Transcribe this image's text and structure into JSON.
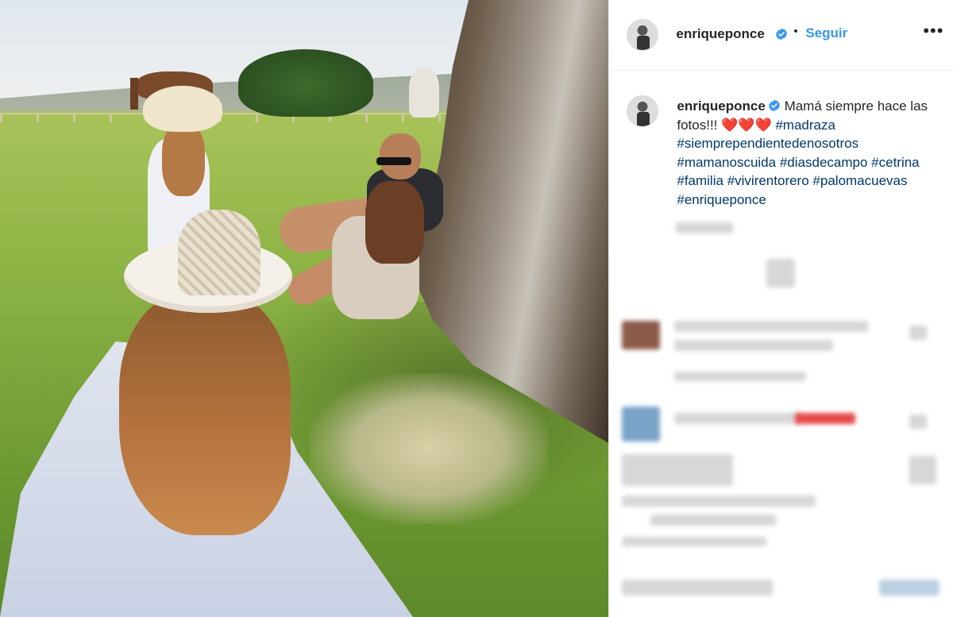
{
  "post": {
    "author": {
      "username": "enriqueponce",
      "verified": true,
      "avatar_icon": "profile-photo"
    },
    "header": {
      "separator": "•",
      "follow_label": "Seguir",
      "more_label": "•••"
    },
    "caption": {
      "text": "Mamá siempre hace las fotos!!! ❤️❤️❤️",
      "hashtags": [
        "#madraza",
        "#siemprependientedenosotros",
        "#mamanoscuida",
        "#diasdecampo",
        "#cetrina",
        "#familia",
        "#vivirentorero",
        "#palomacuevas",
        "#enriqueponce"
      ]
    }
  },
  "colors": {
    "follow_blue": "#3897f0",
    "verified_blue": "#3897f0",
    "hashtag": "#00376b",
    "text": "#262626",
    "border": "#efefef"
  }
}
